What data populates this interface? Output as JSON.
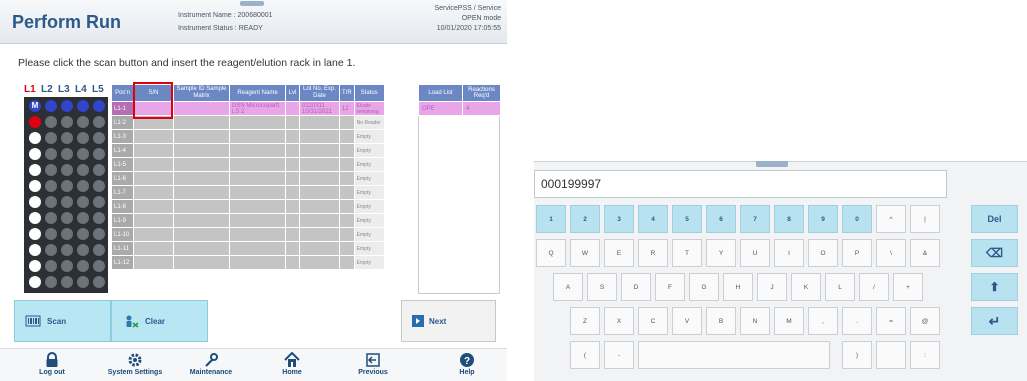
{
  "header": {
    "title": "Perform Run",
    "instrument_name": "Instrument Name : 200680001",
    "instrument_status": "Instrument Status : READY",
    "service_user": "ServicePSS / Service",
    "mode": "OPEN mode",
    "datetime": "10/01/2020 17:05:55"
  },
  "instruction": "Please click the scan button and insert the reagent/elution rack in lane 1.",
  "lanes": [
    "L1",
    "L2",
    "L3",
    "L4",
    "L5"
  ],
  "rack": {
    "lane_colors": {
      "lane1": "#ffffff",
      "lane_other": "#6d7279",
      "selected_marker": "#3344cc",
      "active_marker": "#e00010"
    },
    "first_marker": "M"
  },
  "table": {
    "headers": [
      "Pos'n",
      "S/N",
      "Sample ID Sample Matrix",
      "Reagent Name",
      "Lvl",
      "Lot No. Exp. Date",
      "T/R",
      "Status"
    ],
    "rows": [
      {
        "pos": "L1-1",
        "sn": "",
        "sample": "",
        "reagent": "DSN Microcopartt LS 2",
        "lvl": "",
        "lot": "0120311 10/31/2021",
        "tr": "12",
        "status": "Eluate remaining"
      },
      {
        "pos": "L1-2",
        "sn": "",
        "sample": "",
        "reagent": "",
        "lvl": "",
        "lot": "",
        "tr": "",
        "status": "No Reader"
      },
      {
        "pos": "L1-3",
        "sn": "",
        "sample": "",
        "reagent": "",
        "lvl": "",
        "lot": "",
        "tr": "",
        "status": "Empty"
      },
      {
        "pos": "L1-4",
        "sn": "",
        "sample": "",
        "reagent": "",
        "lvl": "",
        "lot": "",
        "tr": "",
        "status": "Empty"
      },
      {
        "pos": "L1-5",
        "sn": "",
        "sample": "",
        "reagent": "",
        "lvl": "",
        "lot": "",
        "tr": "",
        "status": "Empty"
      },
      {
        "pos": "L1-6",
        "sn": "",
        "sample": "",
        "reagent": "",
        "lvl": "",
        "lot": "",
        "tr": "",
        "status": "Empty"
      },
      {
        "pos": "L1-7",
        "sn": "",
        "sample": "",
        "reagent": "",
        "lvl": "",
        "lot": "",
        "tr": "",
        "status": "Empty"
      },
      {
        "pos": "L1-8",
        "sn": "",
        "sample": "",
        "reagent": "",
        "lvl": "",
        "lot": "",
        "tr": "",
        "status": "Empty"
      },
      {
        "pos": "L1-9",
        "sn": "",
        "sample": "",
        "reagent": "",
        "lvl": "",
        "lot": "",
        "tr": "",
        "status": "Empty"
      },
      {
        "pos": "L1-10",
        "sn": "",
        "sample": "",
        "reagent": "",
        "lvl": "",
        "lot": "",
        "tr": "",
        "status": "Empty"
      },
      {
        "pos": "L1-11",
        "sn": "",
        "sample": "",
        "reagent": "",
        "lvl": "",
        "lot": "",
        "tr": "",
        "status": "Empty"
      },
      {
        "pos": "L1-12",
        "sn": "",
        "sample": "",
        "reagent": "",
        "lvl": "",
        "lot": "",
        "tr": "",
        "status": "Empty"
      }
    ]
  },
  "load_list": {
    "headers": [
      "Load List",
      "Reactions Req'd"
    ],
    "rows": [
      {
        "name": "OPE",
        "req": "4"
      }
    ]
  },
  "buttons": {
    "scan": "Scan",
    "clear": "Clear",
    "next": "Next"
  },
  "nav": [
    {
      "label": "Log out",
      "icon": "lock-icon"
    },
    {
      "label": "System Settings",
      "icon": "gear-icon"
    },
    {
      "label": "Maintenance",
      "icon": "wrench-icon"
    },
    {
      "label": "Home",
      "icon": "home-icon"
    },
    {
      "label": "Previous",
      "icon": "previous-icon"
    },
    {
      "label": "Help",
      "icon": "help-icon"
    }
  ],
  "keyboard": {
    "input_value": "000199997",
    "row1": [
      "1",
      "2",
      "3",
      "4",
      "5",
      "6",
      "7",
      "8",
      "9",
      "0",
      "^",
      "|"
    ],
    "row2": [
      "Q",
      "W",
      "E",
      "R",
      "T",
      "Y",
      "U",
      "I",
      "O",
      "P",
      "\\",
      "&"
    ],
    "row3": [
      "A",
      "S",
      "D",
      "F",
      "G",
      "H",
      "J",
      "K",
      "L",
      "/",
      "+"
    ],
    "row4": [
      "Z",
      "X",
      "C",
      "V",
      "B",
      "N",
      "M",
      ",",
      ".",
      "=",
      "@"
    ],
    "row5": [
      "(",
      "-",
      "",
      ")",
      ":"
    ],
    "special": {
      "del": "Del",
      "backspace": "⌫",
      "shift": "⬆",
      "enter": "↵"
    }
  },
  "colors": {
    "accent": "#2a5a8a",
    "table_header": "#6b88c4",
    "selected_row": "#e8a6e8",
    "highlight_box": "#e00010",
    "cyan_button": "#b8e6f2"
  }
}
